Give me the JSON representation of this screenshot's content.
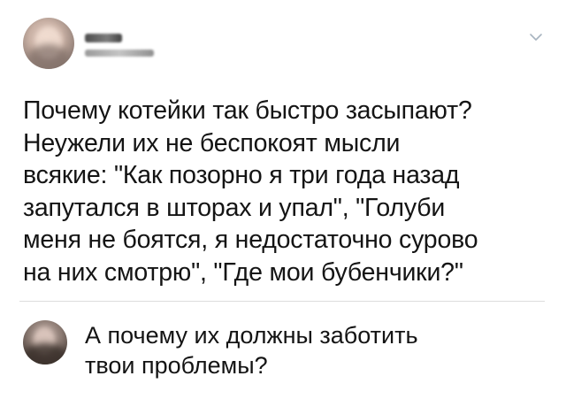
{
  "post": {
    "author_name": "",
    "author_handle": "",
    "menu_icon": "chevron-down-icon",
    "text_lines": [
      "Почему котейки так быстро засыпают?",
      "Неужели их не беспокоят мысли",
      "всякие: \"Как позорно я три года назад",
      "запутался в шторах и упал\", \"Голуби",
      "меня не боятся, я недостаточно сурово",
      "на них смотрю\", \"Где мои бубенчики?\""
    ]
  },
  "reply": {
    "text_lines": [
      "А почему их должны заботить",
      "твои проблемы?"
    ]
  },
  "colors": {
    "background": "#ffffff",
    "text": "#141414",
    "divider": "#dcdcdc",
    "chevron": "#a8b4c0"
  }
}
